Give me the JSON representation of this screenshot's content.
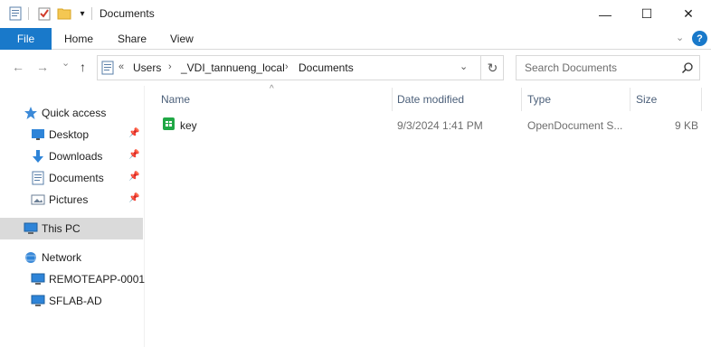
{
  "window": {
    "title": "Documents",
    "minimize": "—",
    "maximize": "☐",
    "close": "✕"
  },
  "ribbon": {
    "file_tab": "File",
    "tabs": [
      "Home",
      "Share",
      "View"
    ],
    "help": "?"
  },
  "navigation": {
    "back": "←",
    "forward": "→",
    "recent": "⌄",
    "up": "↑",
    "breadcrumb_overflow": "«",
    "breadcrumb": [
      "Users",
      "_VDI_tannueng_local",
      "Documents"
    ],
    "breadcrumb_separator": "›",
    "search_placeholder": "Search Documents"
  },
  "sidebar": {
    "quick_access": {
      "label": "Quick access",
      "items": [
        {
          "label": "Desktop",
          "pinned": true
        },
        {
          "label": "Downloads",
          "pinned": true
        },
        {
          "label": "Documents",
          "pinned": true
        },
        {
          "label": "Pictures",
          "pinned": true
        }
      ]
    },
    "this_pc": {
      "label": "This PC",
      "selected": true
    },
    "network": {
      "label": "Network",
      "items": [
        {
          "label": "REMOTEAPP-0001"
        },
        {
          "label": "SFLAB-AD"
        }
      ]
    }
  },
  "file_list": {
    "columns": [
      "Name",
      "Date modified",
      "Type",
      "Size"
    ],
    "rows": [
      {
        "name": "key",
        "date_modified": "9/3/2024 1:41 PM",
        "type": "OpenDocument S...",
        "size": "9 KB"
      }
    ]
  },
  "colors": {
    "accent": "#1979ca",
    "selection": "#dadada",
    "header_text": "#4c607a"
  }
}
